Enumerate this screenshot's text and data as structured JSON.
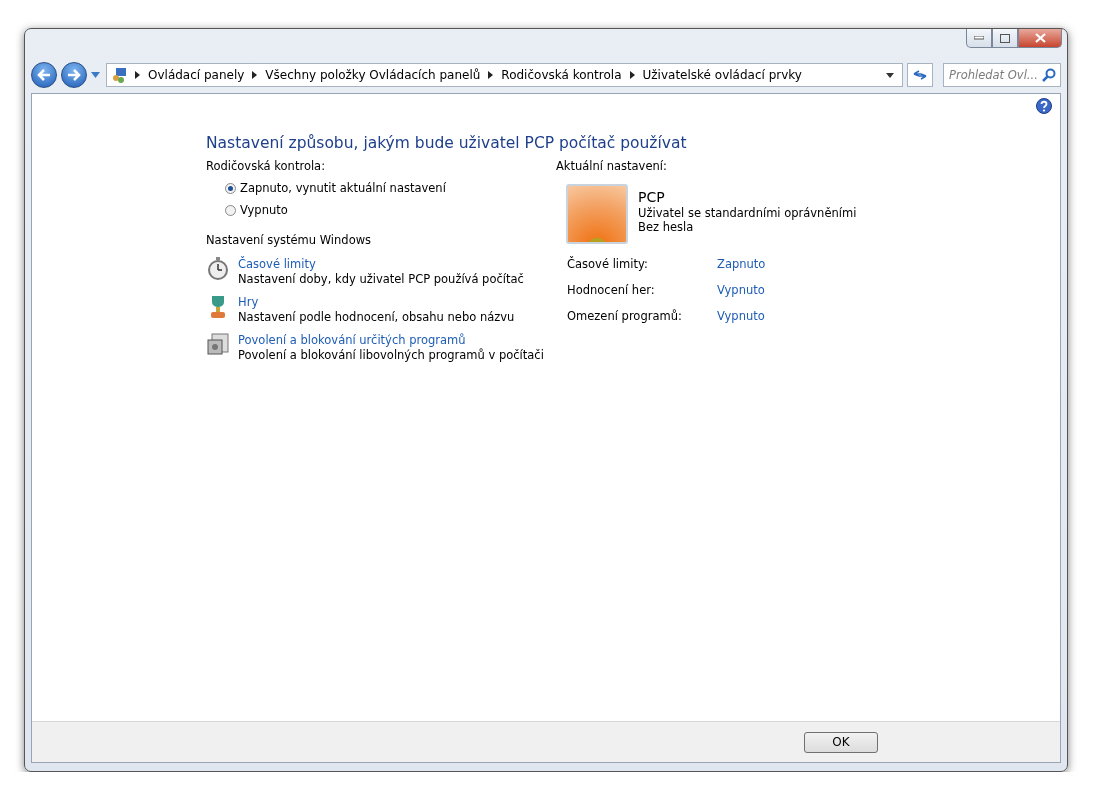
{
  "breadcrumb": [
    "Ovládací panely",
    "Všechny položky Ovládacích panelů",
    "Rodičovská kontrola",
    "Uživatelské ovládací prvky"
  ],
  "search": {
    "placeholder": "Prohledat Ovl..."
  },
  "heading": "Nastavení způsobu, jakým bude uživatel PCP počítač používat",
  "parental_control": {
    "label": "Rodičovská kontrola:",
    "options": [
      {
        "label": "Zapnuto, vynutit aktuální nastavení",
        "selected": true
      },
      {
        "label": "Vypnuto",
        "selected": false
      }
    ]
  },
  "windows_settings": {
    "label": "Nastavení systému Windows",
    "items": [
      {
        "kind": "clock",
        "title": "Časové limity",
        "description": "Nastavení doby, kdy uživatel PCP používá počítač"
      },
      {
        "kind": "trophy",
        "title": "Hry",
        "description": "Nastavení podle hodnocení, obsahu nebo názvu"
      },
      {
        "kind": "programs",
        "title": "Povolení a blokování určitých programů",
        "description": "Povolení a blokování libovolných programů v počítači"
      }
    ]
  },
  "current": {
    "label": "Aktuální nastavení:",
    "user": {
      "name": "PCP",
      "role": "Uživatel se standardními oprávněními",
      "password": "Bez hesla"
    },
    "rows": [
      {
        "label": "Časové limity:",
        "value": "Zapnuto"
      },
      {
        "label": "Hodnocení her:",
        "value": "Vypnuto"
      },
      {
        "label": "Omezení programů:",
        "value": "Vypnuto"
      }
    ]
  },
  "buttons": [
    "OK"
  ]
}
